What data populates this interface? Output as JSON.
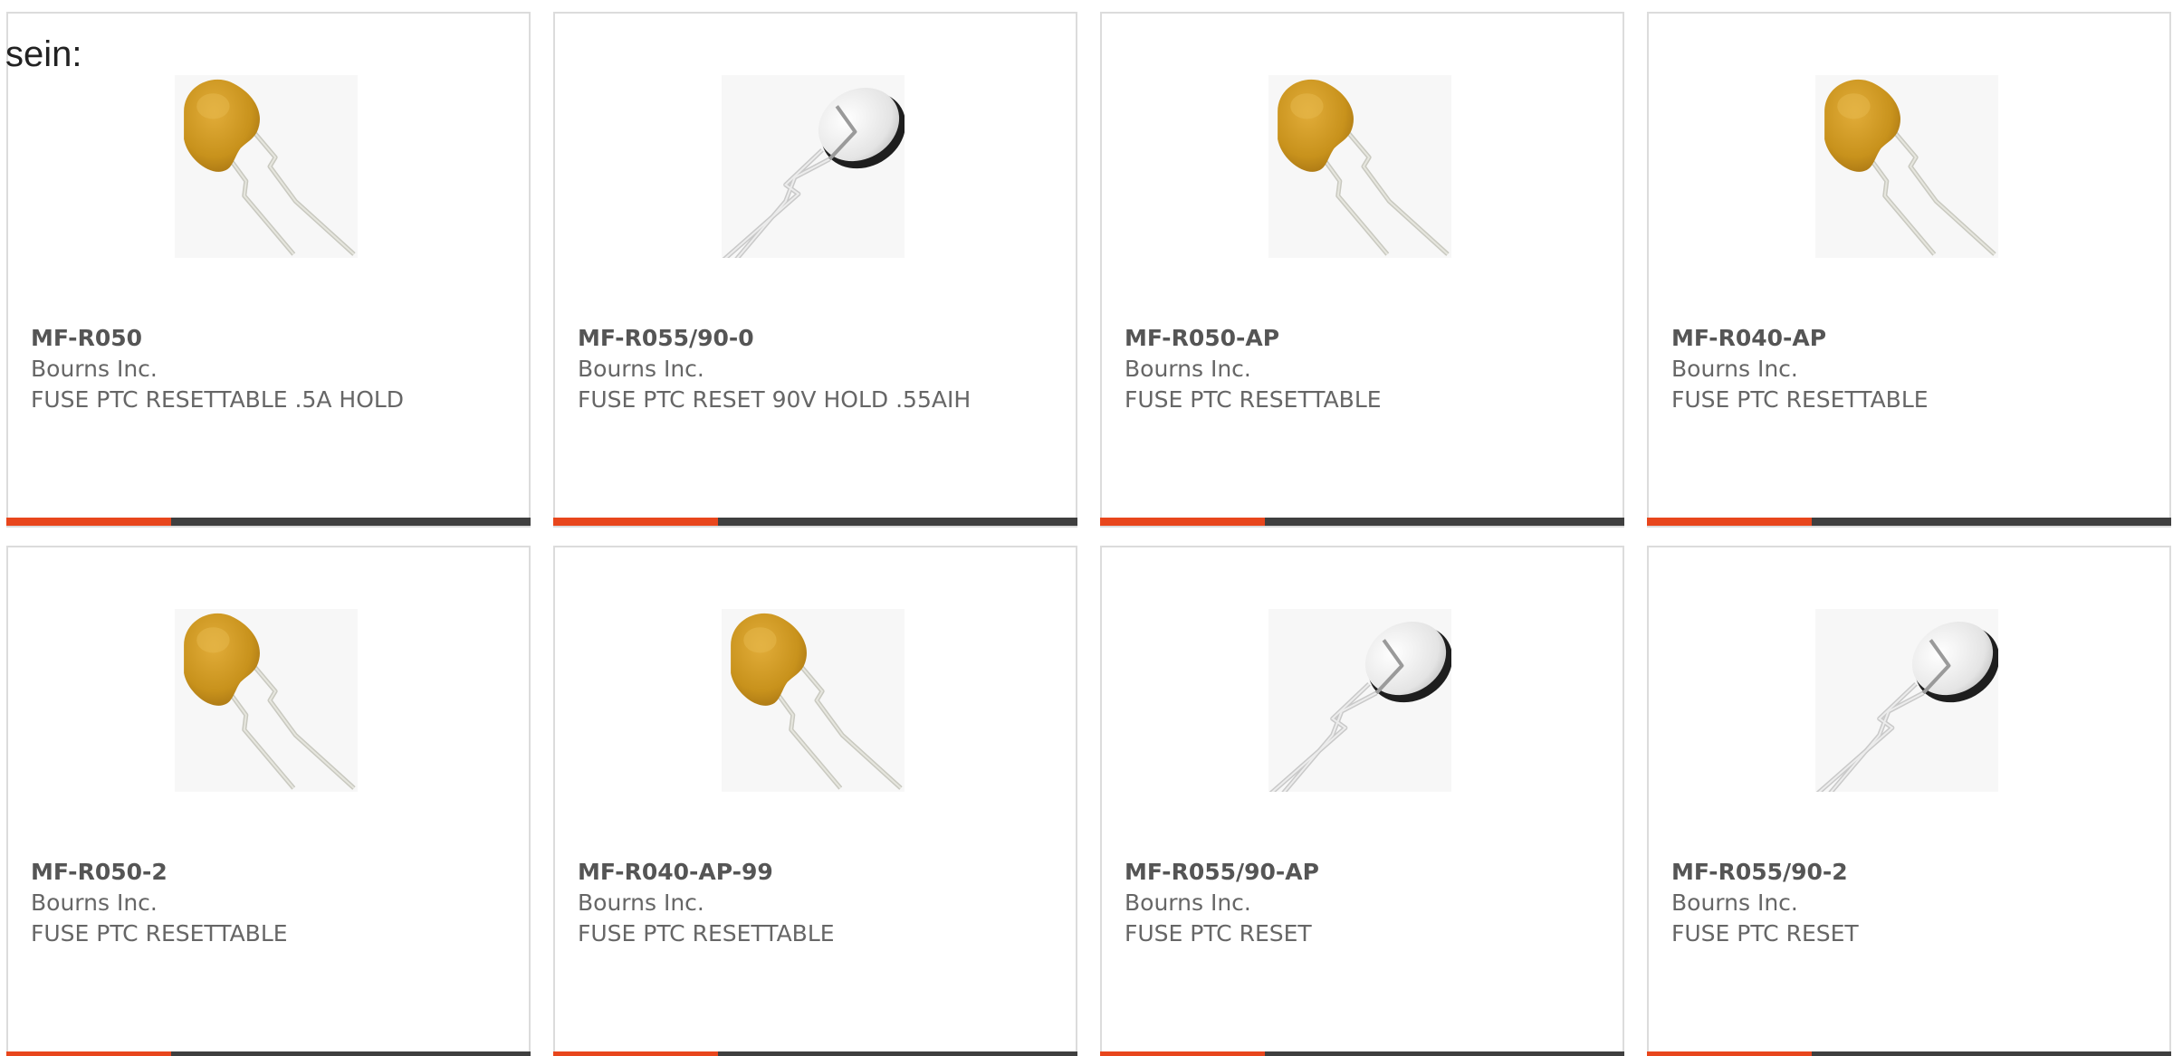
{
  "intro": {
    "text": "sein:"
  },
  "colors": {
    "accent": "#e8461c",
    "bar": "#3f3f3f",
    "border": "#dcdcdc",
    "text": "#666666"
  },
  "products": [
    {
      "part_number": "MF-R050",
      "manufacturer": "Bourns Inc.",
      "description": "FUSE PTC RESETTABLE .5A HOLD",
      "icon": "radial-ptc-fuse-yellow"
    },
    {
      "part_number": "MF-R055/90-0",
      "manufacturer": "Bourns Inc.",
      "description": "FUSE PTC RESET 90V HOLD .55AIH",
      "icon": "radial-ptc-fuse-white"
    },
    {
      "part_number": "MF-R050-AP",
      "manufacturer": "Bourns Inc.",
      "description": "FUSE PTC RESETTABLE",
      "icon": "radial-ptc-fuse-yellow"
    },
    {
      "part_number": "MF-R040-AP",
      "manufacturer": "Bourns Inc.",
      "description": "FUSE PTC RESETTABLE",
      "icon": "radial-ptc-fuse-yellow"
    },
    {
      "part_number": "MF-R050-2",
      "manufacturer": "Bourns Inc.",
      "description": "FUSE PTC RESETTABLE",
      "icon": "radial-ptc-fuse-yellow"
    },
    {
      "part_number": "MF-R040-AP-99",
      "manufacturer": "Bourns Inc.",
      "description": "FUSE PTC RESETTABLE",
      "icon": "radial-ptc-fuse-yellow"
    },
    {
      "part_number": "MF-R055/90-AP",
      "manufacturer": "Bourns Inc.",
      "description": "FUSE PTC RESET",
      "icon": "radial-ptc-fuse-white"
    },
    {
      "part_number": "MF-R055/90-2",
      "manufacturer": "Bourns Inc.",
      "description": "FUSE PTC RESET",
      "icon": "radial-ptc-fuse-white"
    }
  ]
}
